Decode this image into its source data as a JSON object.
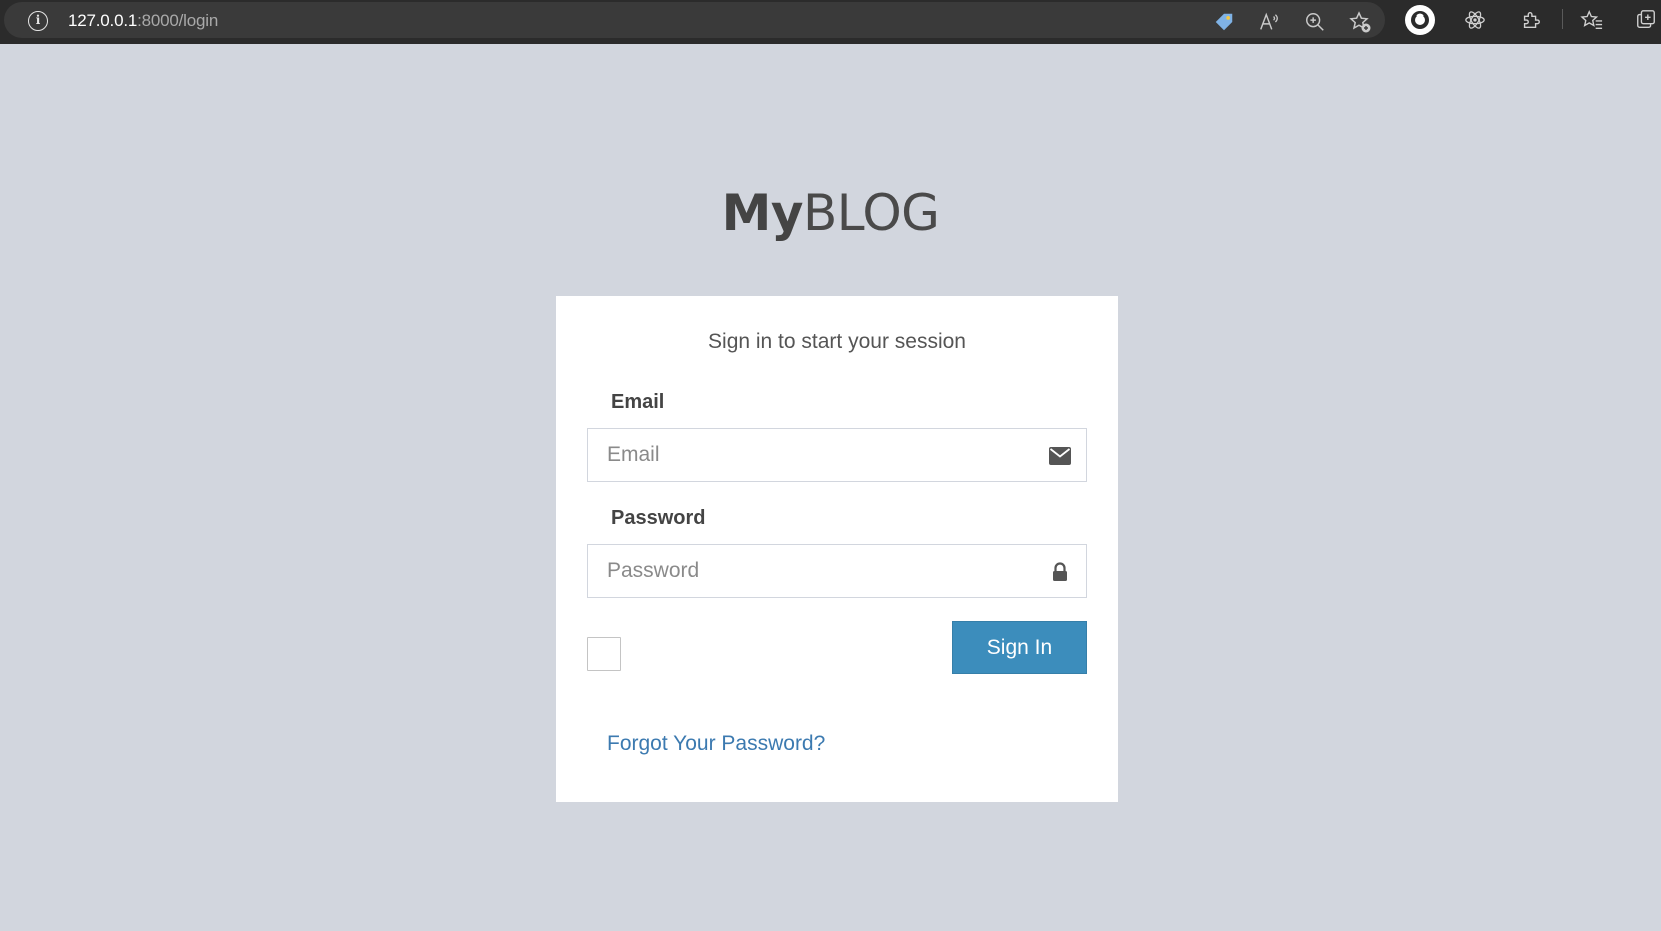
{
  "browser": {
    "url_host": "127.0.0.1",
    "url_rest": ":8000/login",
    "info_icon_glyph": "i",
    "icons": [
      "tag-icon",
      "read-aloud-icon",
      "zoom-icon",
      "add-favorite-icon",
      "profile-icon",
      "react-devtools-icon",
      "extensions-icon",
      "favorites-icon",
      "collections-icon"
    ]
  },
  "logo": {
    "bold": "My",
    "light": "BLOG"
  },
  "login": {
    "message": "Sign in to start your session",
    "email_label": "Email",
    "email_placeholder": "Email",
    "email_value": "",
    "password_label": "Password",
    "password_placeholder": "Password",
    "password_value": "",
    "remember_checked": false,
    "sign_in_label": "Sign In",
    "forgot_link": "Forgot Your Password?"
  },
  "colors": {
    "page_bg": "#d2d6de",
    "primary": "#3c8dbc",
    "link": "#3c7ab0",
    "browser_bar": "#2b2b2b"
  }
}
